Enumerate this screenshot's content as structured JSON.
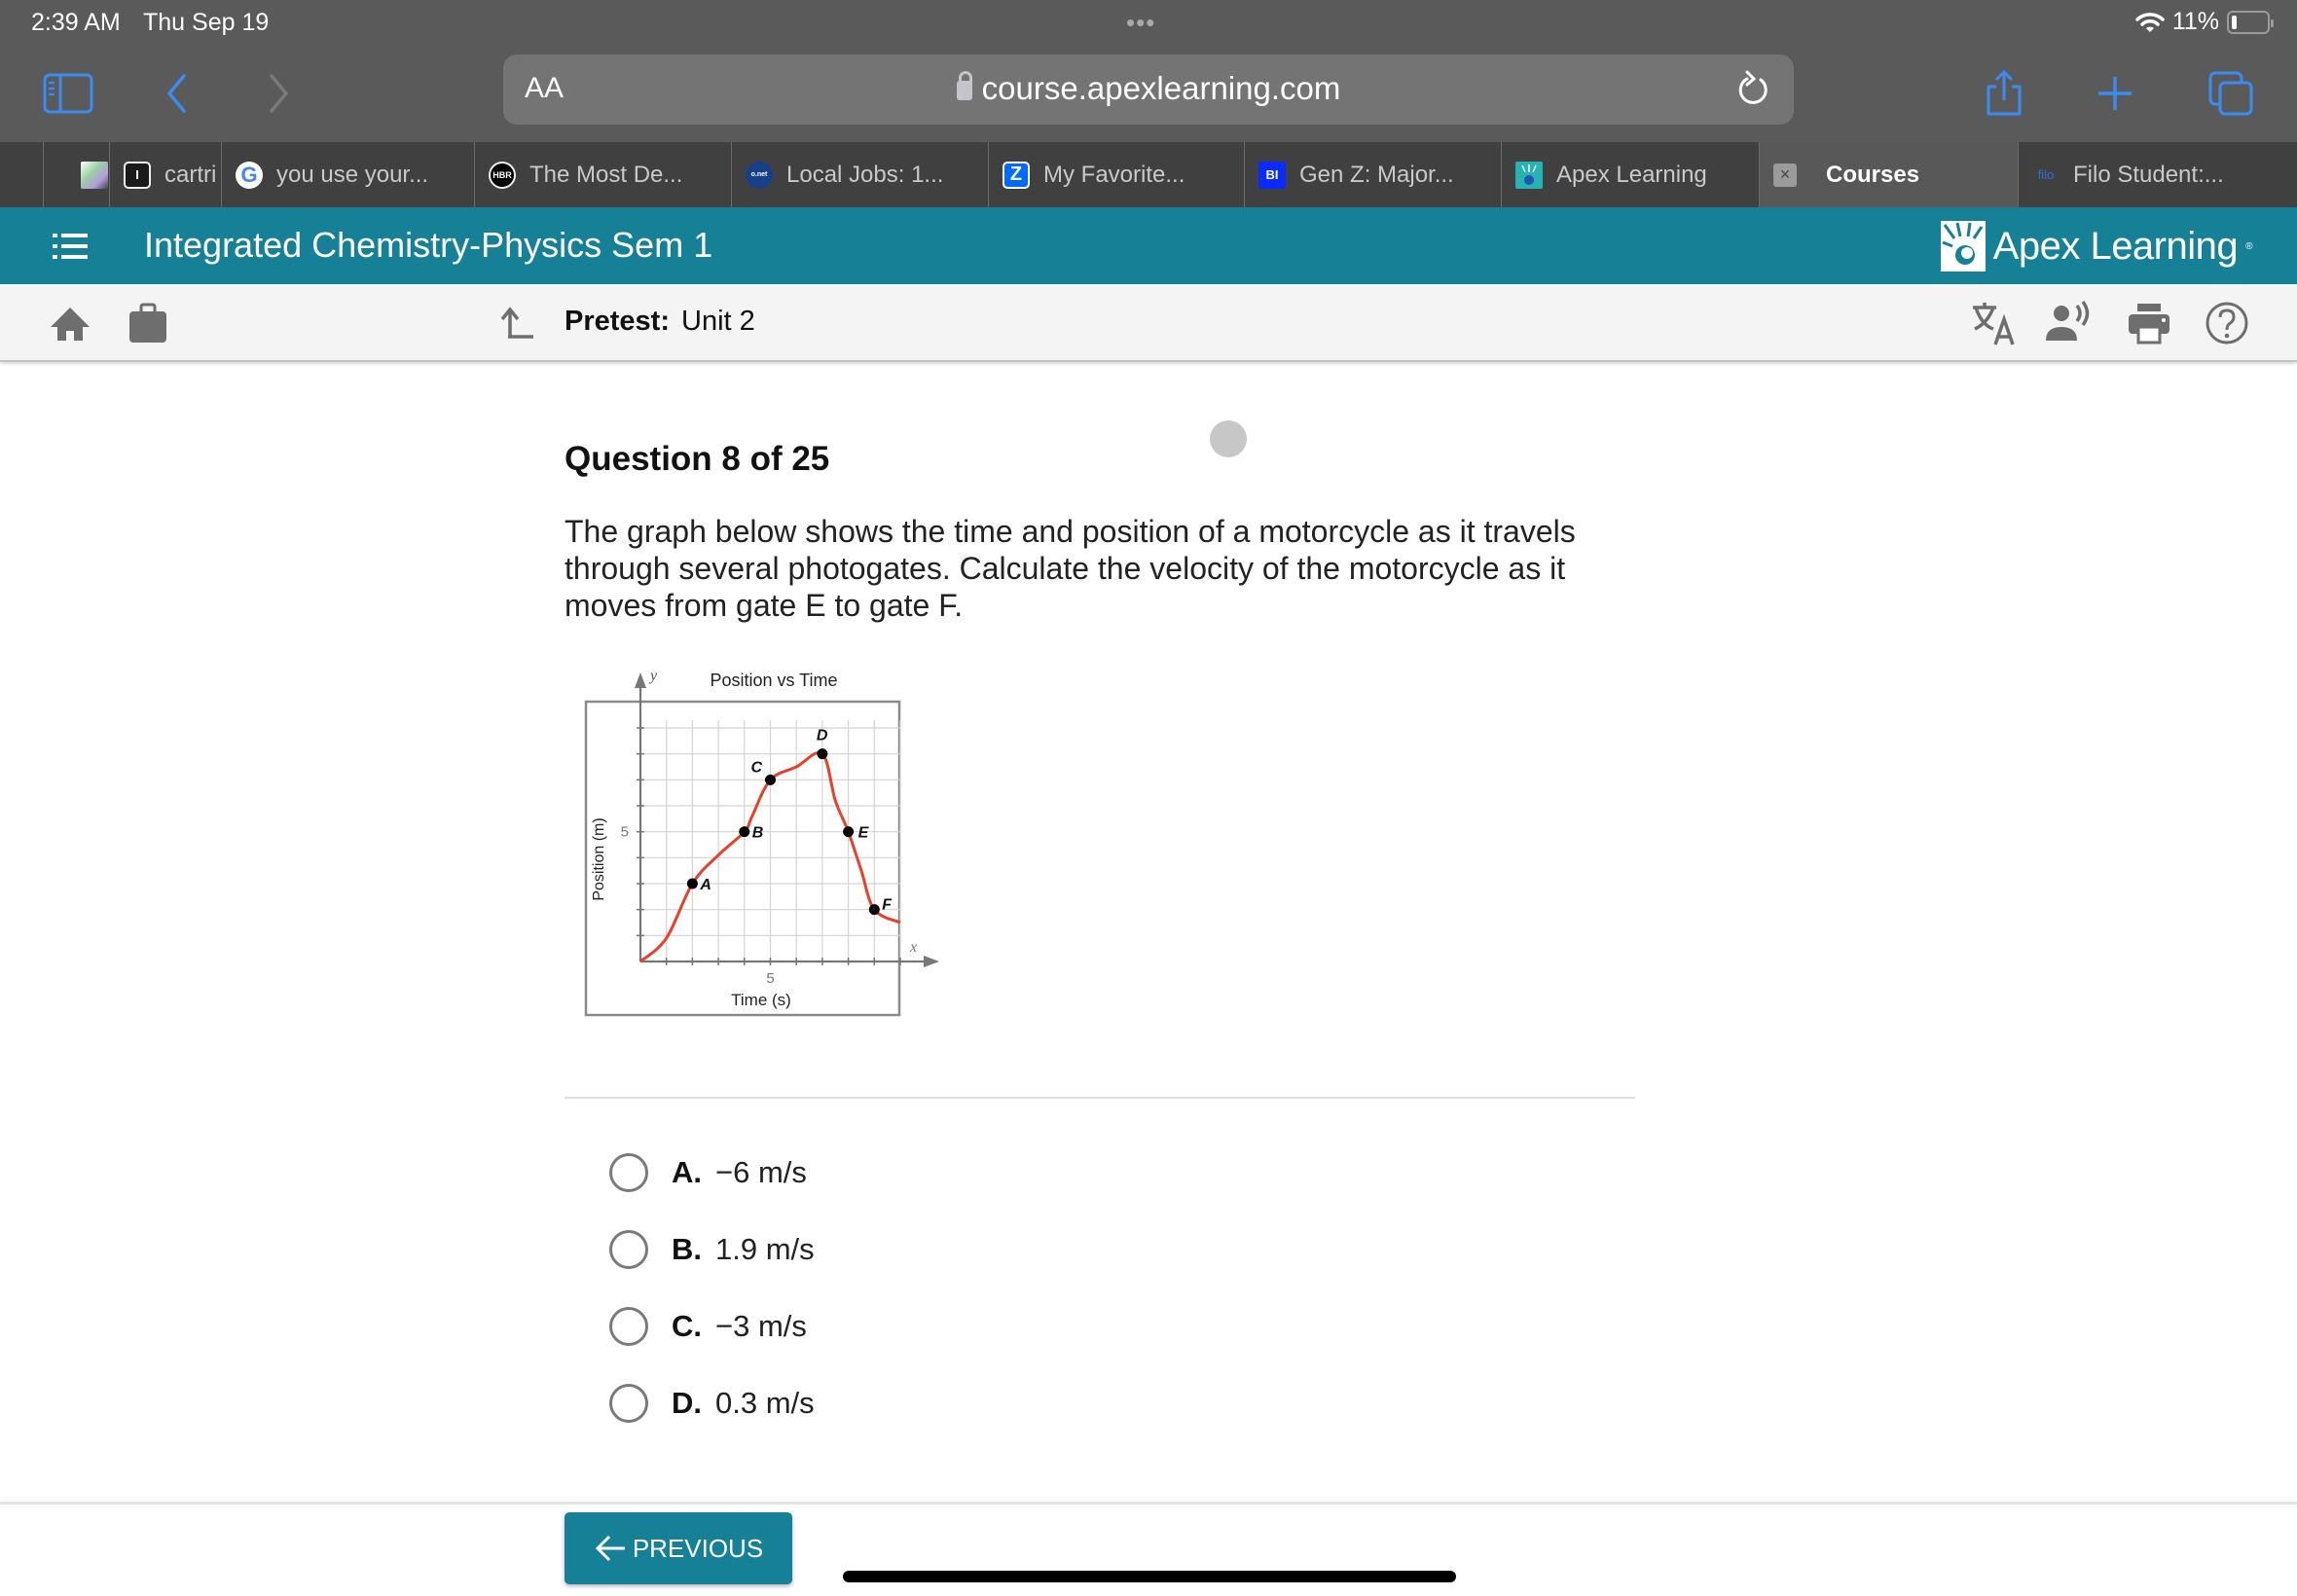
{
  "status_bar": {
    "time": "2:39 AM",
    "date": "Thu Sep 19",
    "battery": "11%",
    "more_dots": "•••"
  },
  "safari": {
    "text_size_label": "AA",
    "url": "course.apexlearning.com",
    "accent_color": "#3b8cf2"
  },
  "tabs": [
    {
      "label": "",
      "favicon": "geometric-favicon"
    },
    {
      "label": "cartri",
      "favicon": "i-favicon"
    },
    {
      "label": "you use your...",
      "favicon": "google-favicon"
    },
    {
      "label": "The Most De...",
      "favicon": "hbr-favicon",
      "favicon_text": "HBR"
    },
    {
      "label": "Local Jobs: 1...",
      "favicon": "onet-favicon",
      "favicon_text": "o.net"
    },
    {
      "label": "My Favorite...",
      "favicon": "zillow-favicon"
    },
    {
      "label": "Gen Z: Major...",
      "favicon": "bi-favicon",
      "favicon_text": "BI"
    },
    {
      "label": "Apex Learning",
      "favicon": "apex-favicon"
    },
    {
      "label": "Courses",
      "favicon": "close-tab",
      "active": true
    },
    {
      "label": "Filo Student:...",
      "favicon": "filo-favicon",
      "favicon_text": "filo"
    }
  ],
  "header": {
    "course_title": "Integrated Chemistry-Physics Sem 1",
    "brand": "Apex Learning",
    "brand_color": "#168196"
  },
  "subheader": {
    "activity_type": "Pretest:",
    "activity_name": "Unit 2"
  },
  "question": {
    "title": "Question 8 of 25",
    "text": "The graph below shows the time and position of a motorcycle as it travels through several photogates. Calculate the velocity of the motorcycle as it moves from gate E to gate F.",
    "choices": [
      {
        "letter": "A.",
        "text": "−6 m/s"
      },
      {
        "letter": "B.",
        "text": "1.9 m/s"
      },
      {
        "letter": "C.",
        "text": "−3 m/s"
      },
      {
        "letter": "D.",
        "text": "0.3 m/s"
      }
    ]
  },
  "chart_data": {
    "type": "line",
    "title": "Position vs Time",
    "xlabel": "Time (s)",
    "ylabel": "Position (m)",
    "x_axis_letter": "x",
    "y_axis_letter": "y",
    "xlim": [
      0,
      10
    ],
    "ylim": [
      0,
      9
    ],
    "x_tick_labels": [
      {
        "value": 5,
        "label": "5"
      }
    ],
    "y_tick_labels": [
      {
        "value": 5,
        "label": "5"
      }
    ],
    "grid": true,
    "curve_color": "#e8402a",
    "curve": [
      [
        0,
        0
      ],
      [
        1,
        0.9
      ],
      [
        2,
        3
      ],
      [
        3,
        4.1
      ],
      [
        4,
        5
      ],
      [
        4.3,
        5.6
      ],
      [
        5,
        7
      ],
      [
        6,
        7.5
      ],
      [
        7,
        8
      ],
      [
        7.5,
        6.2
      ],
      [
        8,
        5
      ],
      [
        8.5,
        3.5
      ],
      [
        9,
        2
      ],
      [
        10,
        1.5
      ]
    ],
    "points": [
      {
        "label": "A",
        "x": 2,
        "y": 3
      },
      {
        "label": "B",
        "x": 4,
        "y": 5
      },
      {
        "label": "C",
        "x": 5,
        "y": 7
      },
      {
        "label": "D",
        "x": 7,
        "y": 8
      },
      {
        "label": "E",
        "x": 8,
        "y": 5
      },
      {
        "label": "F",
        "x": 9,
        "y": 2
      }
    ]
  },
  "footer": {
    "previous_label": "PREVIOUS"
  }
}
